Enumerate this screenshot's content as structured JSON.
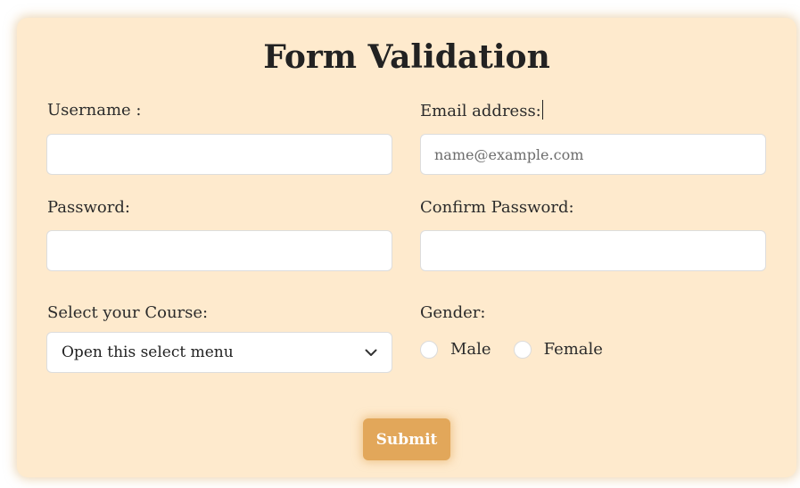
{
  "form": {
    "title": "Form Validation",
    "username": {
      "label": "Username :",
      "value": "",
      "placeholder": ""
    },
    "email": {
      "label": "Email address:",
      "value": "",
      "placeholder": "name@example.com"
    },
    "password": {
      "label": "Password:",
      "value": "",
      "placeholder": ""
    },
    "confirm_password": {
      "label": "Confirm Password:",
      "value": "",
      "placeholder": ""
    },
    "course": {
      "label": "Select your Course:",
      "selected": "Open this select menu"
    },
    "gender": {
      "label": "Gender:",
      "options": [
        "Male",
        "Female"
      ]
    },
    "submit_label": "Submit"
  },
  "colors": {
    "card_background": "#feeacd",
    "submit_background": "#e2a75a",
    "submit_text": "#ffffff",
    "input_background": "#ffffff"
  },
  "icons": {
    "select_arrow": "chevron-down-icon"
  }
}
